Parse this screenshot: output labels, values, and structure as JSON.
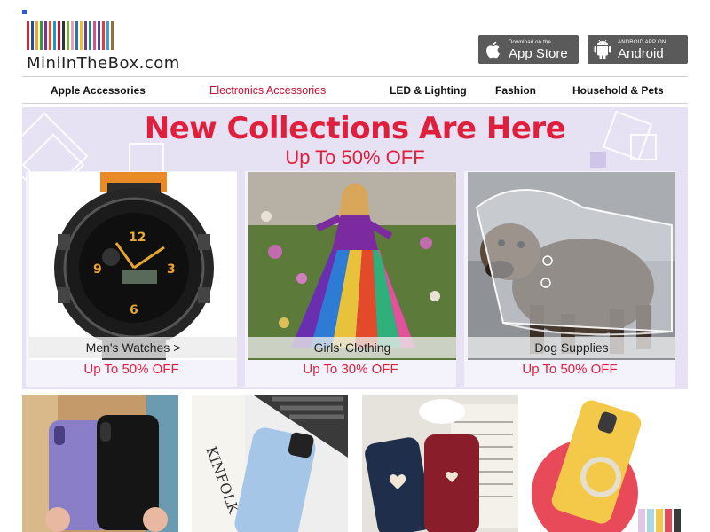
{
  "colors": {
    "accent_red": "#e01f3d",
    "nav_active": "#c8102e",
    "banner_bg": "#e7e2f3",
    "badge_bg": "#5a5a5a"
  },
  "logo": {
    "text": "MiniInTheBox.com",
    "stripe_colors": [
      "#d6252e",
      "#1c4fa0",
      "#f2a51a",
      "#2e9a3f",
      "#8a2d8f",
      "#e5531a",
      "#1b99c4",
      "#c8102e",
      "#333333",
      "#7fb23a",
      "#e7a1c0",
      "#2a6fb8",
      "#f0c419",
      "#6b3e8f",
      "#1f8c7a",
      "#d94f8a",
      "#4a4a9c",
      "#e03a3e",
      "#3aa0d8",
      "#9c6b2e"
    ]
  },
  "app_badges": {
    "appstore": {
      "small": "Download on the",
      "big": "App Store",
      "icon": "apple-icon"
    },
    "android": {
      "small": "ANDROID APP ON",
      "big": "Android",
      "icon": "android-icon"
    }
  },
  "nav": {
    "items": [
      {
        "label": "Apple Accessories",
        "active": false
      },
      {
        "label": "Electronics Accessories",
        "active": true
      },
      {
        "label": "LED & Lighting",
        "active": false
      },
      {
        "label": "Fashion",
        "active": false
      },
      {
        "label": "Household & Pets",
        "active": false
      }
    ]
  },
  "banner": {
    "title": "New Collections Are Here",
    "subtitle": "Up To 50% OFF",
    "cards": [
      {
        "label": "Men's Watches >",
        "offer": "Up To 50% OFF",
        "image": "mens-watch"
      },
      {
        "label": "Girls' Clothing",
        "offer": "Up To 30% OFF",
        "image": "girl-rainbow-dress"
      },
      {
        "label": "Dog Supplies",
        "offer": "Up To 50% OFF",
        "image": "dog-raincoat"
      }
    ]
  },
  "products": [
    {
      "image": "purple-and-black-phone-cases"
    },
    {
      "image": "light-blue-phone-case-on-laptop"
    },
    {
      "image": "navy-and-red-heart-phone-cases"
    },
    {
      "image": "yellow-ring-phone-case"
    }
  ]
}
